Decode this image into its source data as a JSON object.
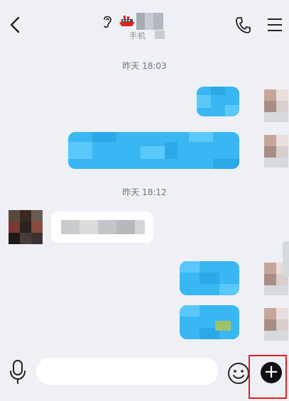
{
  "header": {
    "title": "",
    "subtitle": "手机",
    "icons": {
      "back": "chevron-left-icon",
      "voice_mode": "ear-icon",
      "badge": "ship-icon",
      "call": "phone-icon",
      "menu": "hamburger-menu-icon"
    }
  },
  "timestamps": [
    "昨天 18:03",
    "昨天 18:12"
  ],
  "input_bar": {
    "placeholder": "",
    "icons": {
      "mic": "microphone-icon",
      "emoji": "smiley-icon",
      "more": "plus-icon"
    },
    "plus_symbol": "+"
  },
  "colors": {
    "background": "#eef0f5",
    "sent_bubble": "#39b7f2",
    "received_bubble": "#ffffff",
    "highlight": "#e02020"
  }
}
